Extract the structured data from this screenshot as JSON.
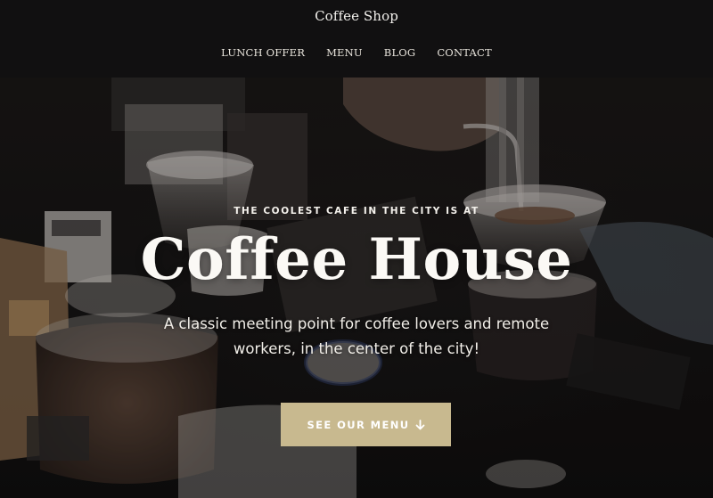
{
  "header": {
    "site_title": "Coffee Shop",
    "nav": [
      "LUNCH OFFER",
      "MENU",
      "BLOG",
      "CONTACT"
    ]
  },
  "hero": {
    "kicker": "THE COOLEST CAFE IN THE CITY IS AT",
    "headline": "Coffee House",
    "subtitle": "A classic meeting point for coffee lovers and remote workers, in the center of the city!",
    "cta_label": "SEE OUR MENU",
    "cta_icon": "arrow-down-icon",
    "background_icon": "coffee-brewing-photo"
  },
  "colors": {
    "header_bg": "#111011",
    "cta_bg": "#c8b98f",
    "text_light": "#f4f1ec"
  }
}
